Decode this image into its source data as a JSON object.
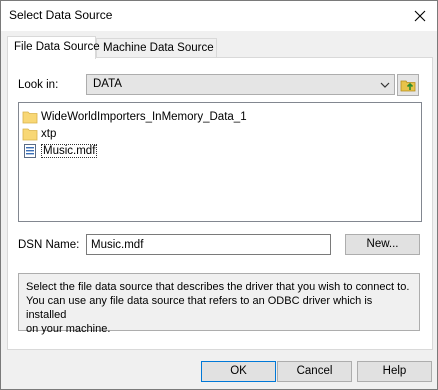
{
  "window": {
    "title": "Select Data Source"
  },
  "tabs": [
    {
      "label": "File Data Source",
      "active": true
    },
    {
      "label": "Machine Data Source",
      "active": false
    }
  ],
  "lookin": {
    "label": "Look in:",
    "value": "DATA"
  },
  "files": [
    {
      "name": "WideWorldImporters_InMemory_Data_1",
      "icon": "folder-icon"
    },
    {
      "name": "xtp",
      "icon": "folder-icon"
    },
    {
      "name": "Music.mdf",
      "icon": "database-file-icon",
      "selected": true
    }
  ],
  "dsn": {
    "label": "DSN Name:",
    "value": "Music.mdf",
    "new_button": "New..."
  },
  "description": {
    "line1": "Select the file data source that describes the driver that you wish to connect to.",
    "line2": "You can use any file data source that refers to an ODBC driver which is installed",
    "line3": "on your machine."
  },
  "buttons": {
    "ok": "OK",
    "cancel": "Cancel",
    "help": "Help"
  },
  "colors": {
    "accent": "#0078d7",
    "folder": "#f8d775"
  }
}
